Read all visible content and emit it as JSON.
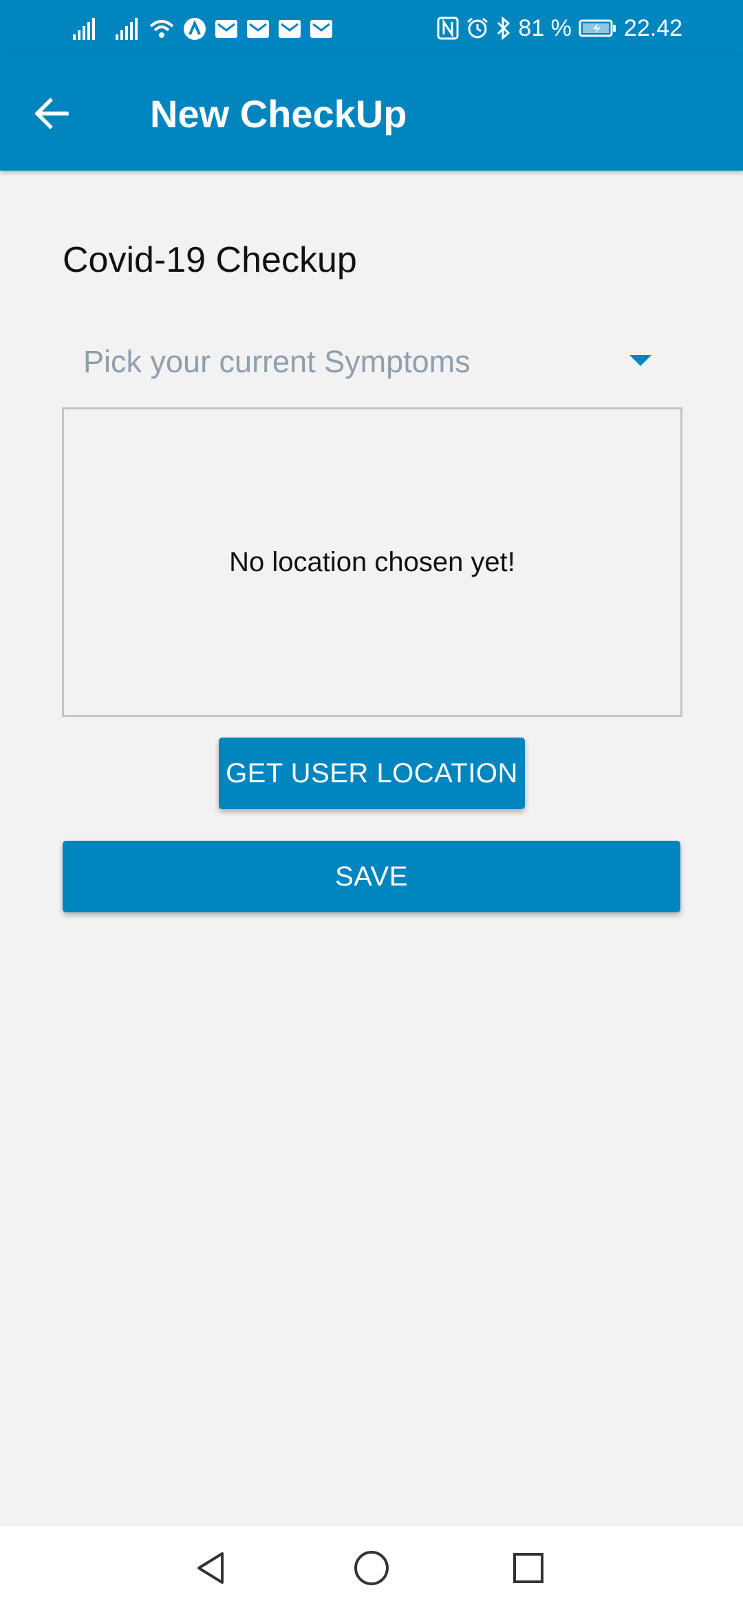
{
  "status_bar": {
    "battery": "81 %",
    "time": "22.42",
    "icons": [
      "signal-icon",
      "signal-icon",
      "wifi-icon",
      "app-icon",
      "mail-icon",
      "mail-icon",
      "mail-icon",
      "mail-icon",
      "nfc-icon",
      "alarm-icon",
      "bluetooth-icon",
      "battery-charging-icon"
    ]
  },
  "app_bar": {
    "title": "New CheckUp",
    "back_icon": "arrow-back-icon"
  },
  "form": {
    "section_title": "Covid-19 Checkup",
    "symptoms_placeholder": "Pick your current  Symptoms",
    "location_placeholder": "No location chosen yet!",
    "get_location_label": "GET USER LOCATION",
    "save_label": "SAVE"
  },
  "nav_bar": {
    "icons": [
      "nav-back-icon",
      "nav-home-icon",
      "nav-recents-icon"
    ]
  },
  "colors": {
    "primary": "#0085be",
    "background": "#f2f2f2",
    "placeholder": "#8f9fae"
  }
}
